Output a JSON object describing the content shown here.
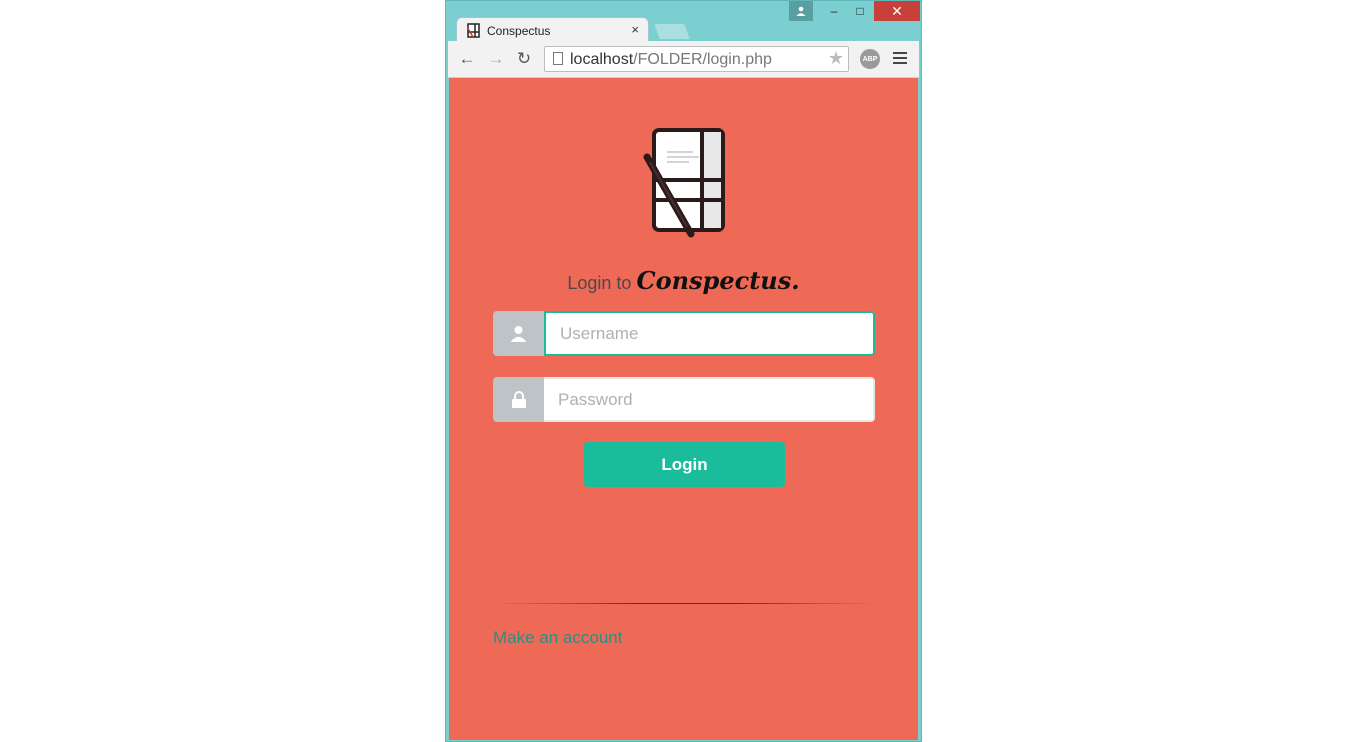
{
  "browser": {
    "tab": {
      "title": "Conspectus",
      "close_glyph": "×"
    },
    "window_controls": {
      "minimize": "–",
      "maximize": "□",
      "close": "✕"
    },
    "toolbar": {
      "url_host": "localhost",
      "url_path": "/FOLDER/login.php",
      "extension_label": "ABP"
    }
  },
  "page": {
    "heading_prefix": "Login to",
    "brand": "Conspectus.",
    "username": {
      "placeholder": "Username",
      "value": ""
    },
    "password": {
      "placeholder": "Password",
      "value": ""
    },
    "login_label": "Login",
    "make_account_label": "Make an account"
  },
  "icons": {
    "tab_favicon": "notebook-icon",
    "user_addon": "user-icon",
    "password_addon": "lock-icon",
    "logo": "notebook-pen-icon"
  },
  "colors": {
    "page_background": "#ee6a57",
    "accent": "#1abc9c",
    "addon": "#bdc3c7",
    "link": "#2f8c80",
    "window_frame": "#7bcfd0",
    "close_button": "#c8403a"
  }
}
